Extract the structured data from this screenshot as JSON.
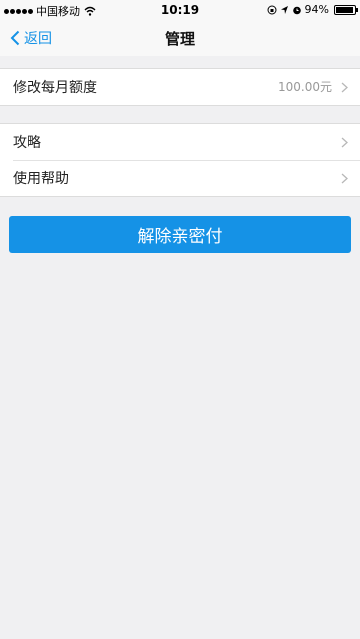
{
  "status_bar": {
    "carrier": "中国移动",
    "time": "10:19",
    "battery": "94%",
    "battery_level": 0.94,
    "icons": [
      "signal-icon",
      "wifi-icon",
      "lock-rotation-icon",
      "location-arrow-icon",
      "alarm-icon",
      "battery-icon"
    ]
  },
  "nav": {
    "back_label": "返回",
    "title": "管理"
  },
  "groups": [
    {
      "items": [
        {
          "label": "修改每月额度",
          "value": "100.00元"
        }
      ]
    },
    {
      "items": [
        {
          "label": "攻略"
        },
        {
          "label": "使用帮助"
        }
      ]
    }
  ],
  "primary_action": {
    "label": "解除亲密付"
  },
  "colors": {
    "accent": "#1592e6",
    "background": "#f0f0f2"
  }
}
